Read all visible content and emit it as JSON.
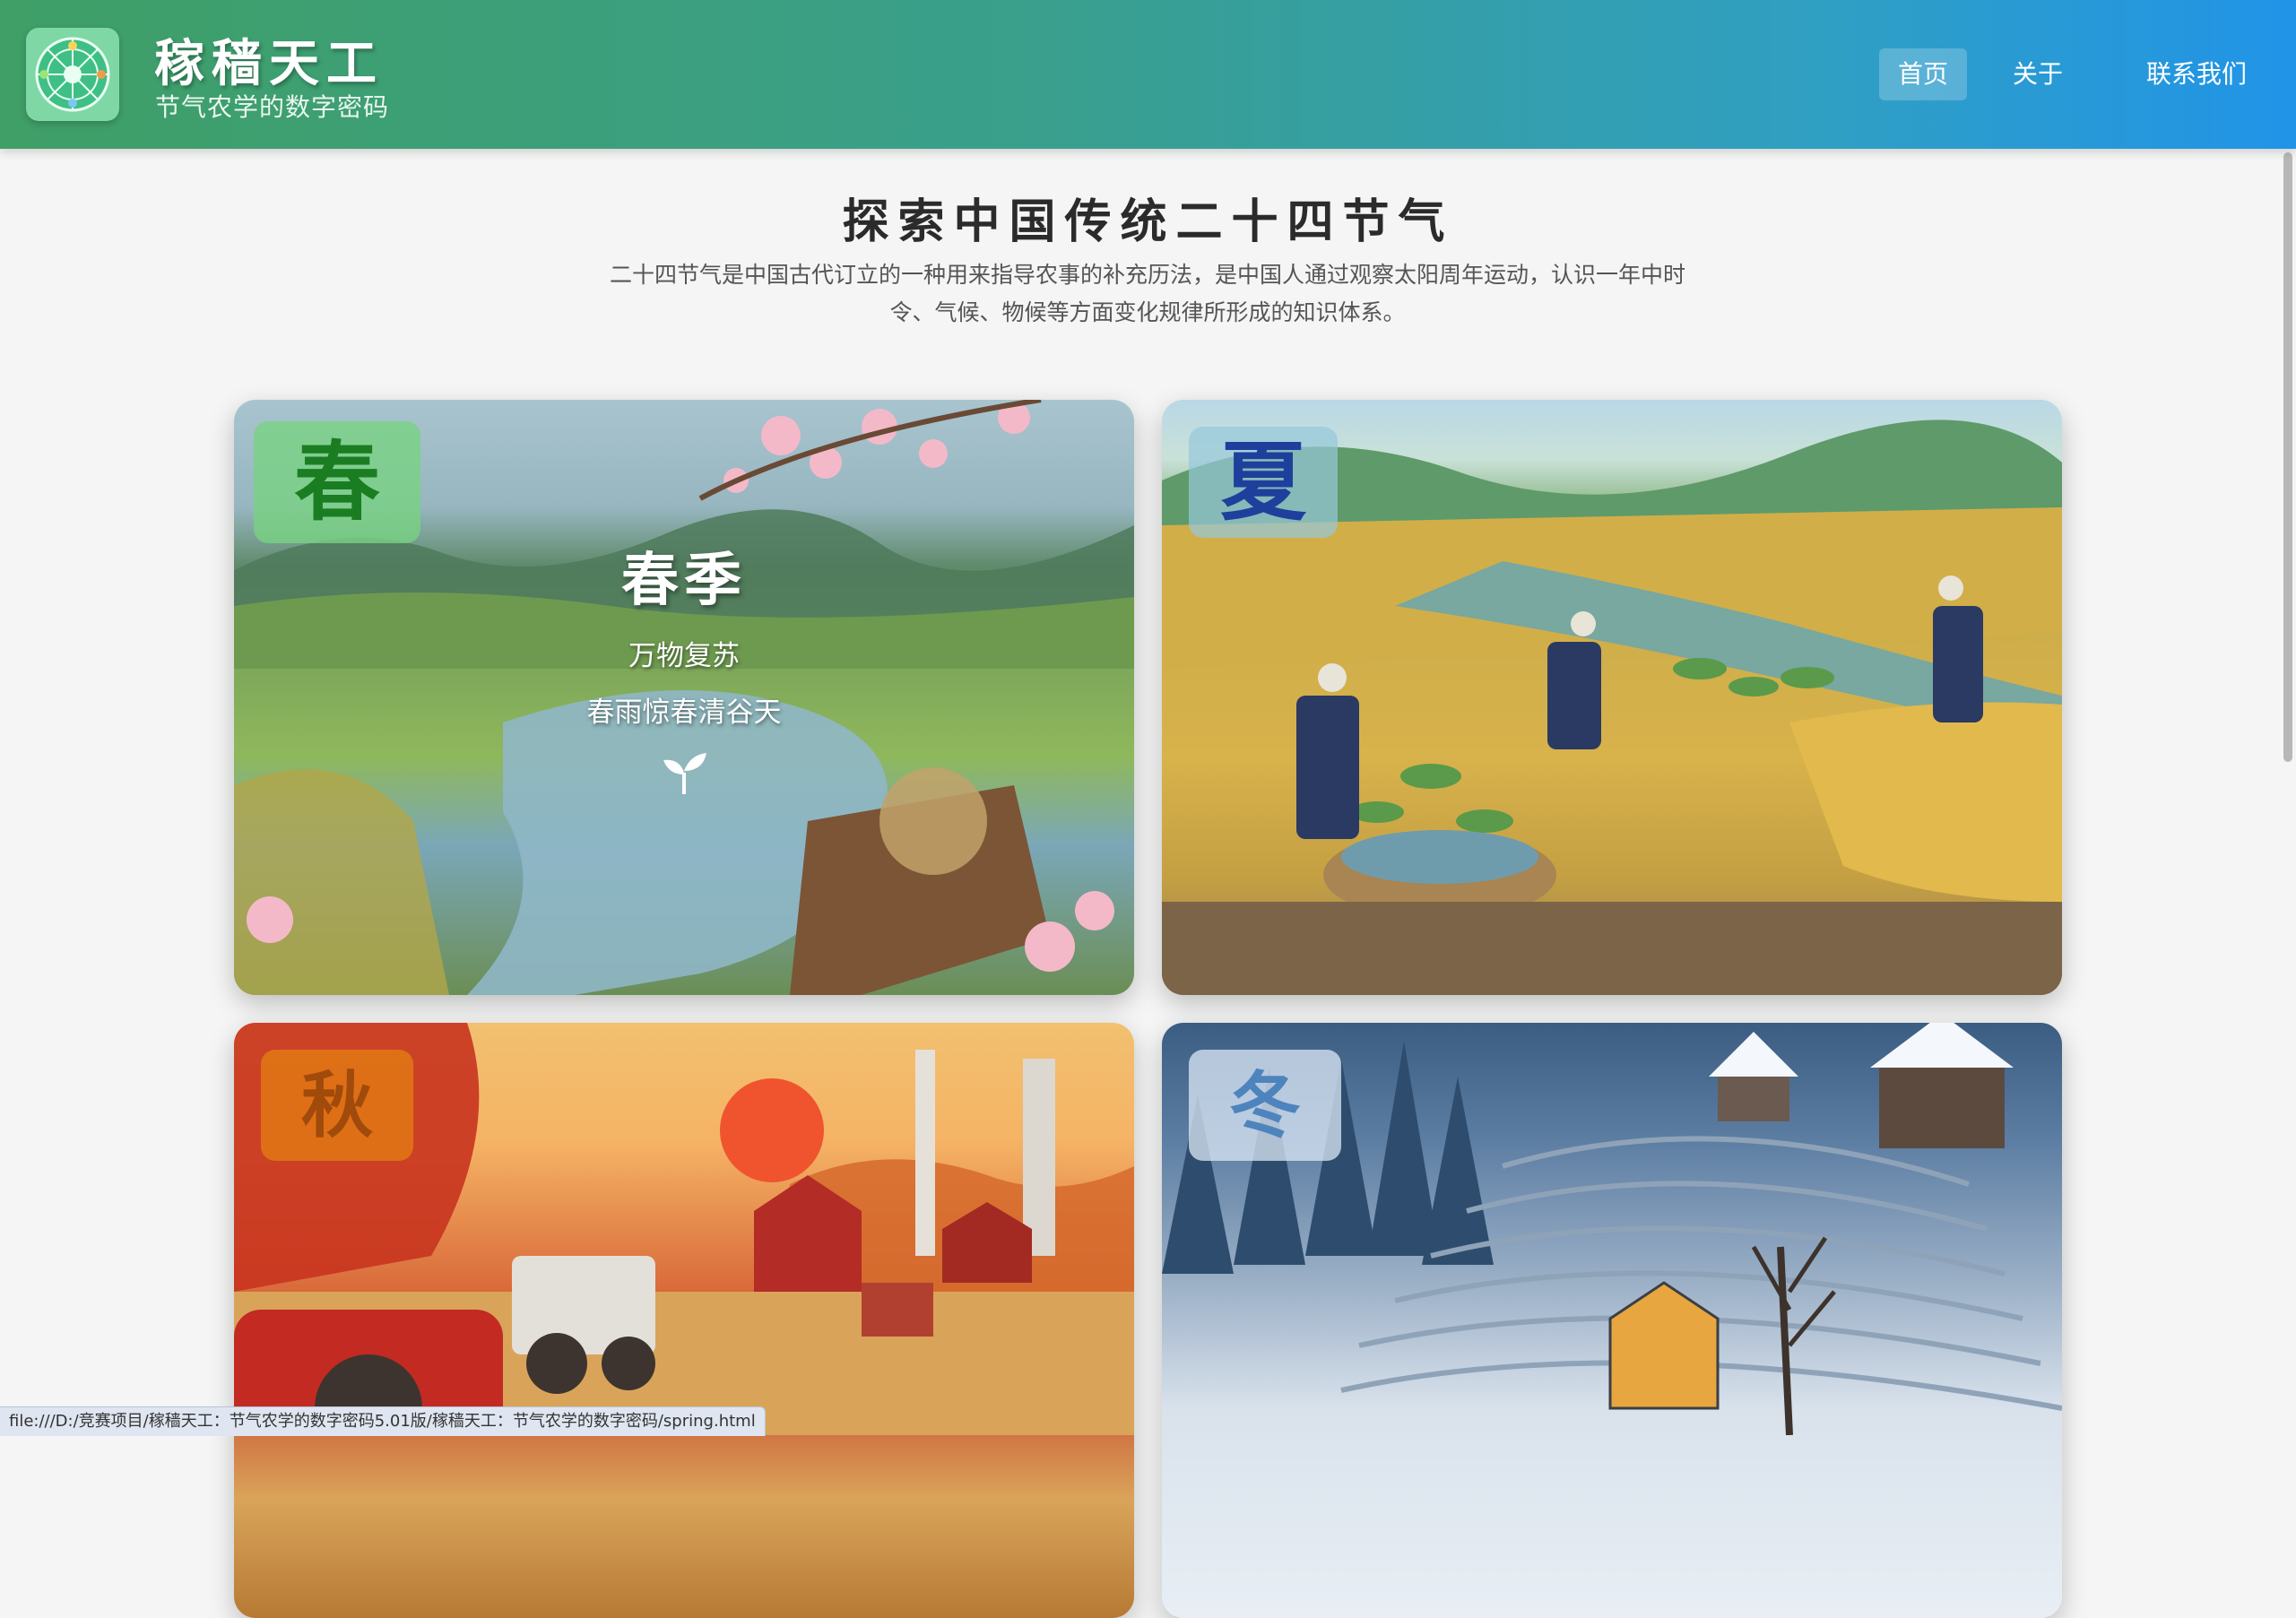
{
  "header": {
    "brand_title": "稼穑天工",
    "brand_subtitle": "节气农学的数字密码",
    "logo_icon": "solar-term-wheel-icon",
    "nav": [
      {
        "label": "首页",
        "active": true
      },
      {
        "label": "关于",
        "active": false
      },
      {
        "label": "联系我们",
        "active": false
      }
    ]
  },
  "intro": {
    "title": "探索中国传统二十四节气",
    "description": "二十四节气是中国古代订立的一种用来指导农事的补充历法，是中国人通过观察太阳周年运动，认识一年中时令、气候、物候等方面变化规律所形成的知识体系。"
  },
  "seasons": [
    {
      "badge": "春",
      "name": "春季",
      "slogan": "万物复苏",
      "terms": "春雨惊春清谷天",
      "icon": "sprout-icon",
      "color": "#1b7d22"
    },
    {
      "badge": "夏",
      "color": "#1f3f9c"
    },
    {
      "badge": "秋",
      "color": "#a04a0b"
    },
    {
      "badge": "冬",
      "color": "#4e84bd"
    }
  ],
  "statusbar": {
    "url": "file:///D:/竞赛项目/稼穑天工：节气农学的数字密码5.01版/稼穑天工：节气农学的数字密码/spring.html"
  }
}
